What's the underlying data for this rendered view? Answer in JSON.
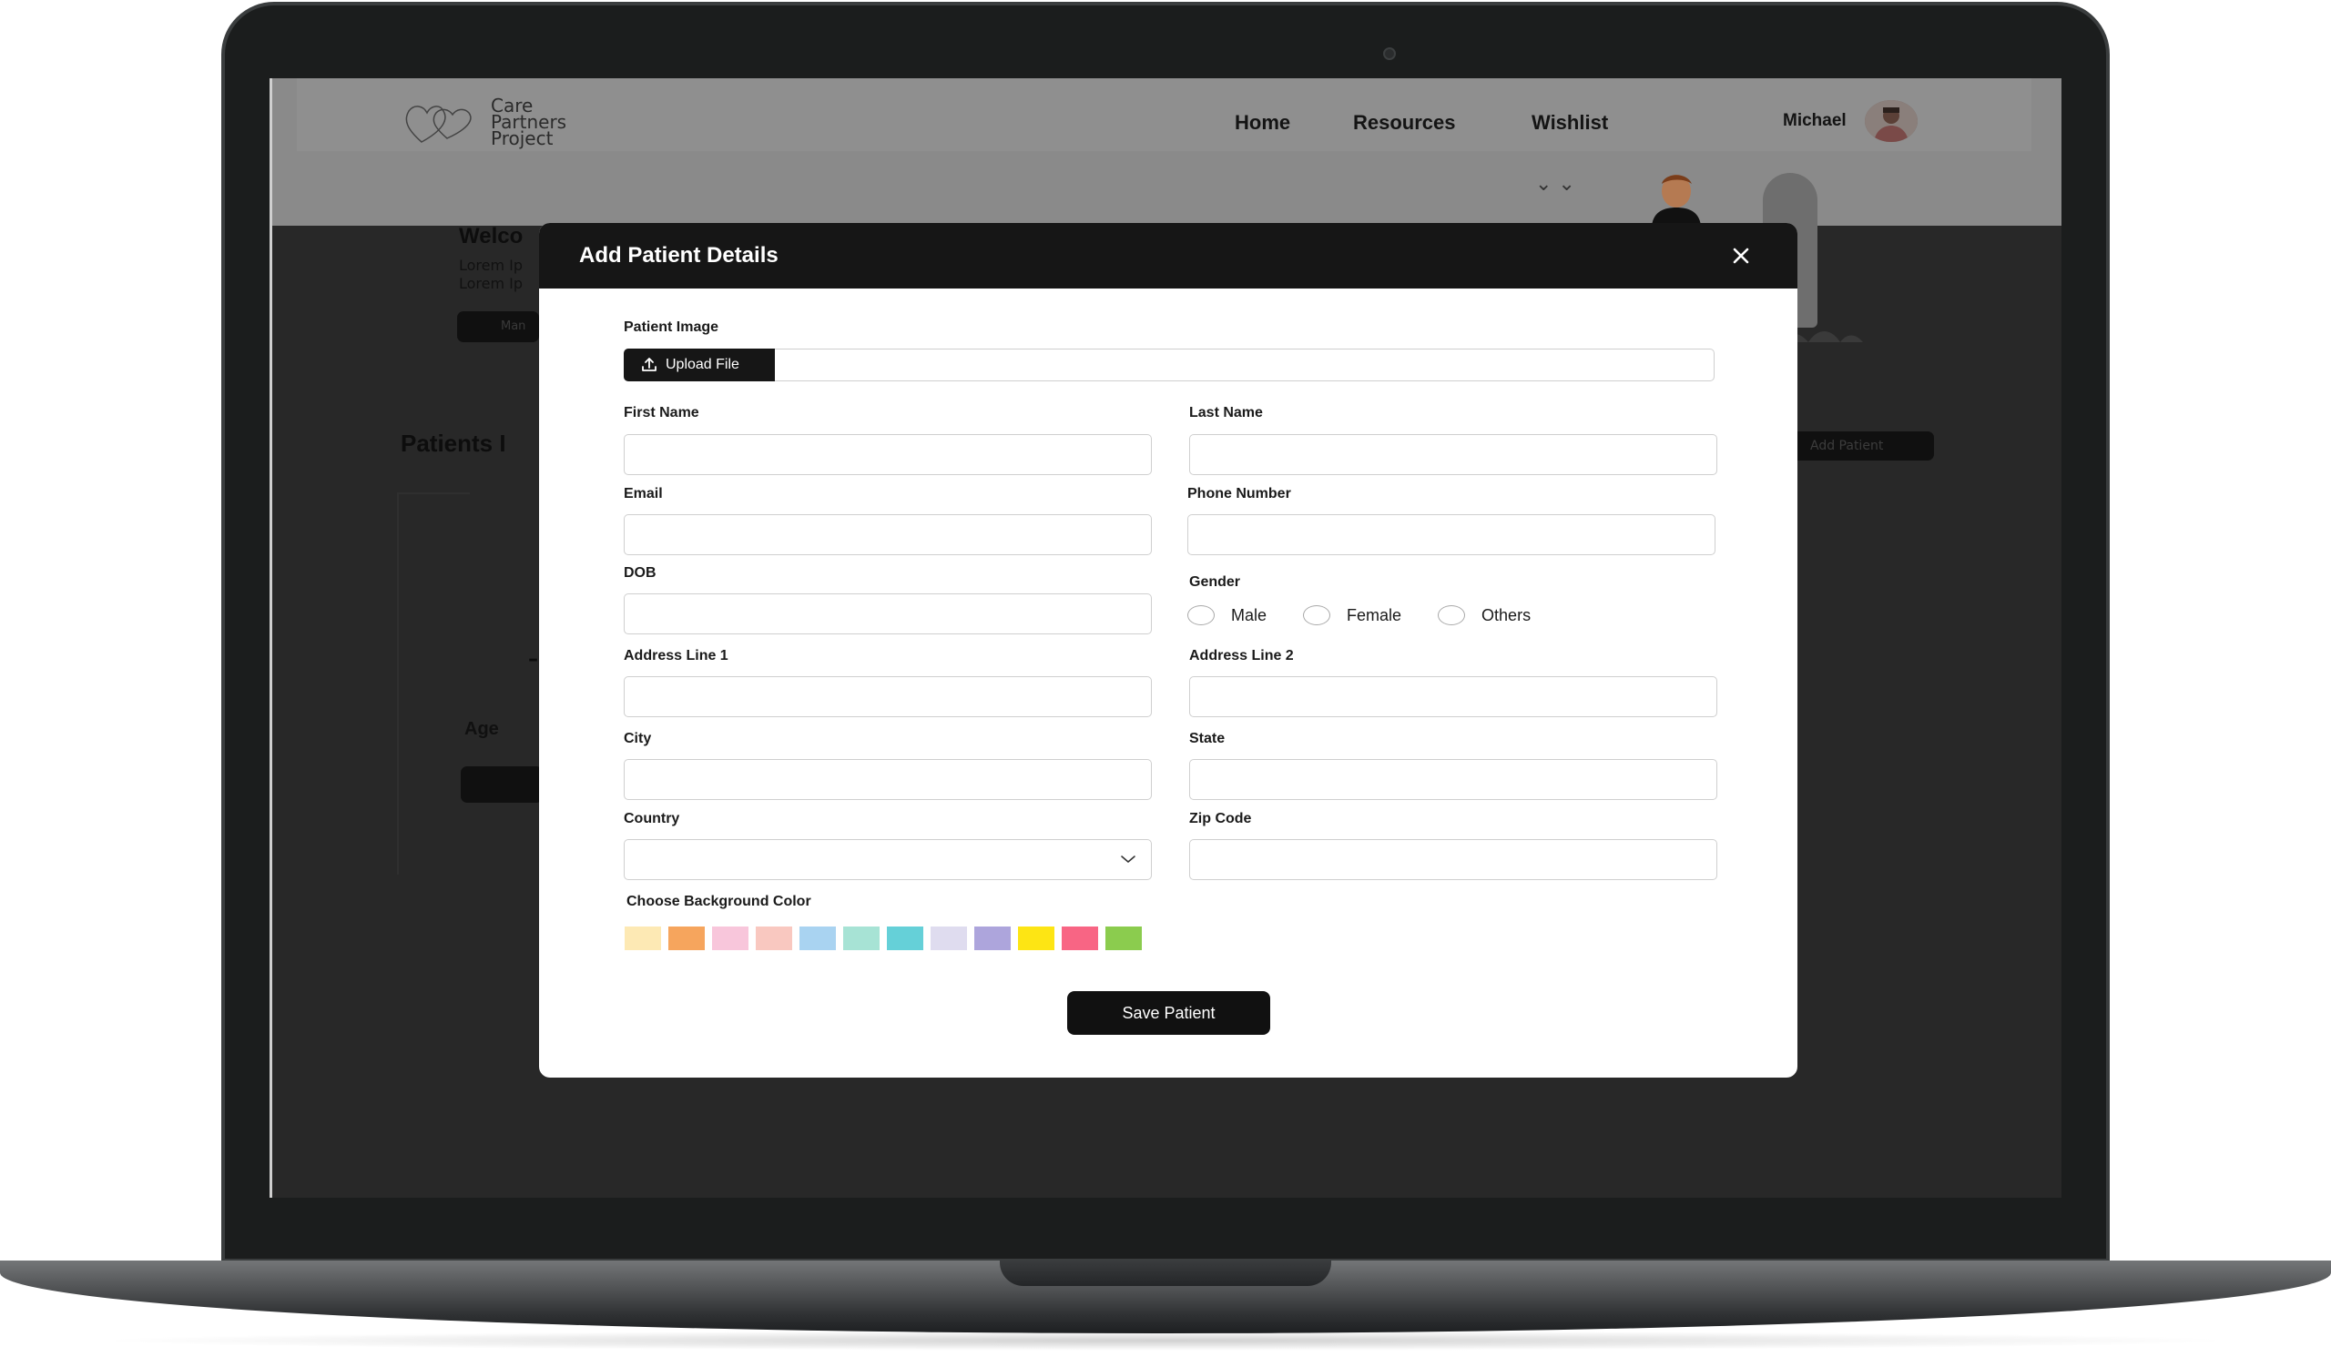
{
  "site": {
    "logo_lines": [
      "Care",
      "Partners",
      "Project"
    ],
    "nav": [
      "Home",
      "Resources",
      "Wishlist"
    ],
    "user_name": "Michael",
    "background": {
      "welcome_fragment": "Welco",
      "lorem_fragment_1": "Lorem Ip",
      "lorem_fragment_2": "Lorem Ip",
      "button_fragment": "Man",
      "section_fragment": "Patients I",
      "add_patient": "Add Patient",
      "age_label": "Age"
    }
  },
  "modal": {
    "title": "Add Patient Details",
    "patient_image_label": "Patient Image",
    "upload_label": "Upload File",
    "fields": {
      "first_name": {
        "label": "First Name",
        "value": ""
      },
      "last_name": {
        "label": "Last Name",
        "value": ""
      },
      "email": {
        "label": "Email",
        "value": ""
      },
      "phone": {
        "label": "Phone Number",
        "value": ""
      },
      "dob": {
        "label": "DOB",
        "value": ""
      },
      "address1": {
        "label": "Address Line 1",
        "value": ""
      },
      "address2": {
        "label": "Address Line 2",
        "value": ""
      },
      "city": {
        "label": "City",
        "value": ""
      },
      "state": {
        "label": "State",
        "value": ""
      },
      "country": {
        "label": "Country",
        "value": ""
      },
      "zip": {
        "label": "Zip Code",
        "value": ""
      }
    },
    "gender": {
      "label": "Gender",
      "options": [
        "Male",
        "Female",
        "Others"
      ],
      "selected": null
    },
    "color_label": "Choose Background Color",
    "colors": [
      "#fde9b4",
      "#f6a55d",
      "#f8c6db",
      "#f9c8c0",
      "#a9d3f1",
      "#a7e3d5",
      "#65d0d8",
      "#dfdcef",
      "#ada5dc",
      "#fde514",
      "#f86584",
      "#8bcc4e"
    ],
    "save_label": "Save Patient"
  }
}
